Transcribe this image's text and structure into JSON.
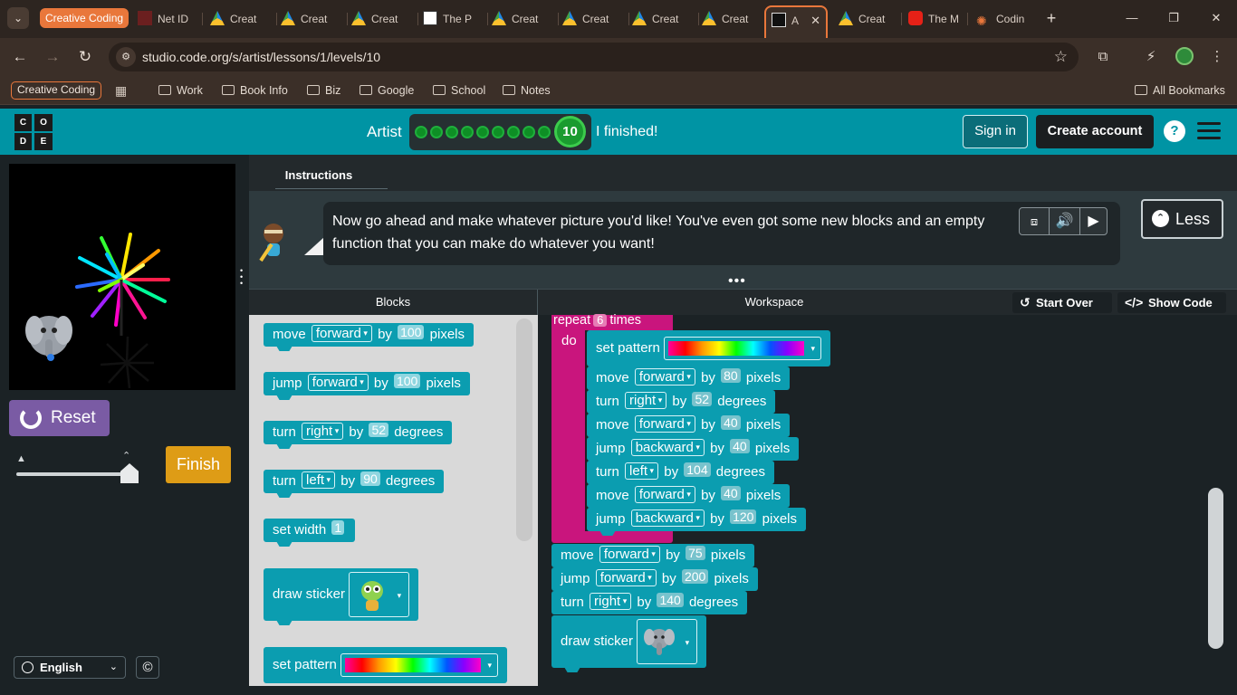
{
  "browser": {
    "group_label": "Creative Coding",
    "tabs": [
      {
        "label": "Net ID",
        "icon": "netid-icon"
      },
      {
        "label": "Creat",
        "icon": "drive-icon"
      },
      {
        "label": "Creat",
        "icon": "drive-icon"
      },
      {
        "label": "Creat",
        "icon": "drive-icon"
      },
      {
        "label": "The P",
        "icon": "apple-icon"
      },
      {
        "label": "Creat",
        "icon": "drive-icon"
      },
      {
        "label": "Creat",
        "icon": "drive-icon"
      },
      {
        "label": "Creat",
        "icon": "drive-icon"
      },
      {
        "label": "Creat",
        "icon": "drive-icon"
      },
      {
        "label": "A",
        "icon": "codeorg-icon",
        "active": true
      },
      {
        "label": "Creat",
        "icon": "drive-icon"
      },
      {
        "label": "The M",
        "icon": "youtube-icon"
      },
      {
        "label": "Codin",
        "icon": "burst-icon"
      }
    ],
    "url": "studio.code.org/s/artist/lessons/1/levels/10",
    "bookmarks": {
      "group_chip": "Creative Coding",
      "items": [
        "Work",
        "Book Info",
        "Biz",
        "Google",
        "School",
        "Notes"
      ],
      "all": "All Bookmarks"
    }
  },
  "header": {
    "logo_letters": [
      "C",
      "O",
      "D",
      "E"
    ],
    "lesson_name": "Artist",
    "current_level": "10",
    "completed_levels": 9,
    "finished_text": "I finished!",
    "signin": "Sign in",
    "create_account": "Create account",
    "help": "?"
  },
  "instructions": {
    "tab": "Instructions",
    "text": "Now go ahead and make whatever picture you'd like! You've even got some new blocks and an empty function that you can make do whatever you want!",
    "less_label": "Less"
  },
  "controls": {
    "reset": "Reset",
    "finish": "Finish",
    "speed": 0.95,
    "language": "English",
    "copyright": "©"
  },
  "workspace_header": {
    "blocks": "Blocks",
    "workspace": "Workspace",
    "start_over": "Start Over",
    "show_code": "Show Code"
  },
  "toolbox": [
    {
      "verb": "move",
      "option": "forward",
      "by": "by",
      "value": "100",
      "unit": "pixels"
    },
    {
      "verb": "jump",
      "option": "forward",
      "by": "by",
      "value": "100",
      "unit": "pixels"
    },
    {
      "verb": "turn",
      "option": "right",
      "by": "by",
      "value": "52",
      "unit": "degrees"
    },
    {
      "verb": "turn",
      "option": "left",
      "by": "by",
      "value": "90",
      "unit": "degrees"
    },
    {
      "verb": "set width",
      "value": "1"
    },
    {
      "verb": "draw sticker"
    },
    {
      "verb": "set pattern"
    }
  ],
  "program": {
    "repeat_label": "repeat",
    "repeat_count": "6",
    "times_label": "times",
    "do_label": "do",
    "set_pattern": "set pattern",
    "loop_body": [
      {
        "verb": "move",
        "option": "forward",
        "by": "by",
        "value": "80",
        "unit": "pixels"
      },
      {
        "verb": "turn",
        "option": "right",
        "by": "by",
        "value": "52",
        "unit": "degrees"
      },
      {
        "verb": "move",
        "option": "forward",
        "by": "by",
        "value": "40",
        "unit": "pixels"
      },
      {
        "verb": "jump",
        "option": "backward",
        "by": "by",
        "value": "40",
        "unit": "pixels"
      },
      {
        "verb": "turn",
        "option": "left",
        "by": "by",
        "value": "104",
        "unit": "degrees"
      },
      {
        "verb": "move",
        "option": "forward",
        "by": "by",
        "value": "40",
        "unit": "pixels"
      },
      {
        "verb": "jump",
        "option": "backward",
        "by": "by",
        "value": "120",
        "unit": "pixels"
      }
    ],
    "after": [
      {
        "verb": "move",
        "option": "forward",
        "by": "by",
        "value": "75",
        "unit": "pixels"
      },
      {
        "verb": "jump",
        "option": "forward",
        "by": "by",
        "value": "200",
        "unit": "pixels"
      },
      {
        "verb": "turn",
        "option": "right",
        "by": "by",
        "value": "140",
        "unit": "degrees"
      }
    ],
    "draw_sticker": "draw sticker"
  },
  "colors": {
    "codeorg_teal": "#0094a4",
    "block_teal": "#0b9db0",
    "loop_pink": "#c9157d",
    "reset_purple": "#7a5ba4",
    "finish_orange": "#de9c16",
    "browser_accent": "#e9773b"
  }
}
